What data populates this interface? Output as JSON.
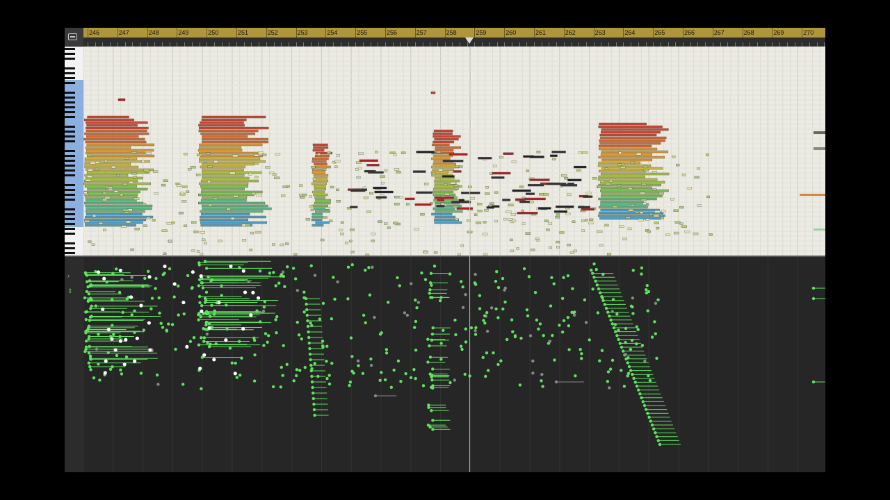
{
  "ruler": {
    "bars": [
      "246",
      "247",
      "248",
      "249",
      "250",
      "251",
      "252",
      "253",
      "254",
      "255",
      "256",
      "257",
      "258",
      "259",
      "260",
      "261",
      "262",
      "263",
      "264",
      "265",
      "266",
      "267",
      "268",
      "269",
      "270"
    ]
  },
  "toolbar": {
    "corner_icon": "local-window-menu-icon"
  },
  "velocity_lane": {
    "collapse_icon": "chevron-right-icon",
    "lane_select_icon": "up-down-arrows-icon",
    "note_color": "#5fe35f",
    "selected_note_color": "#ffffff"
  },
  "colors": {
    "ruler_bg": "#b0963a",
    "roll_bg": "#ebebe3",
    "velocity_bg": "#262626",
    "keyboard_highlight": "#3478d2"
  }
}
